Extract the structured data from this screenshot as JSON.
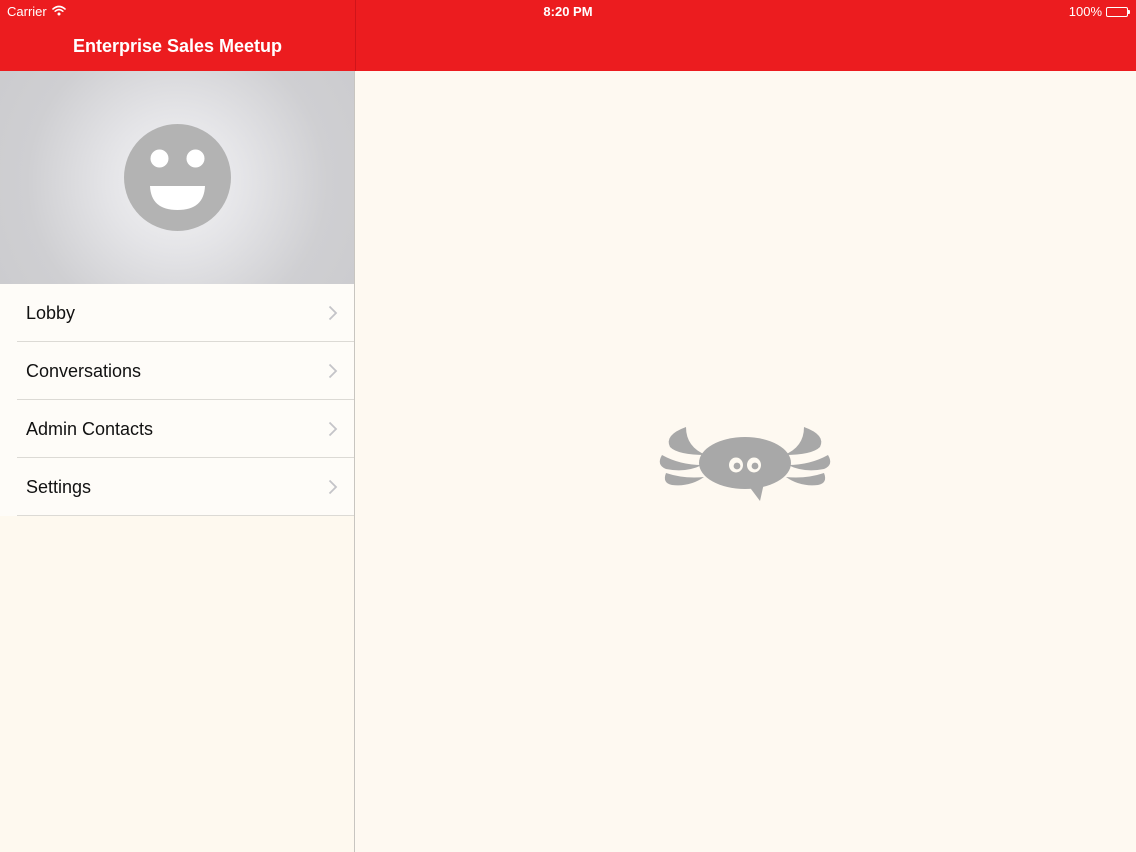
{
  "status_bar": {
    "carrier": "Carrier",
    "time": "8:20 PM",
    "battery": "100%"
  },
  "nav": {
    "title": "Enterprise Sales Meetup"
  },
  "menu": {
    "items": [
      {
        "label": "Lobby"
      },
      {
        "label": "Conversations"
      },
      {
        "label": "Admin Contacts"
      },
      {
        "label": "Settings"
      }
    ]
  },
  "icons": {
    "wifi": "wifi-icon",
    "battery": "battery-icon",
    "avatar": "smiley-avatar-icon",
    "chevron": "chevron-right-icon",
    "mascot": "crab-chat-logo-icon"
  },
  "colors": {
    "brand_red": "#ec1c1f",
    "background": "#fef9f1",
    "avatar_gray": "#b3b3b3",
    "mascot_gray": "#a8a8a8"
  }
}
